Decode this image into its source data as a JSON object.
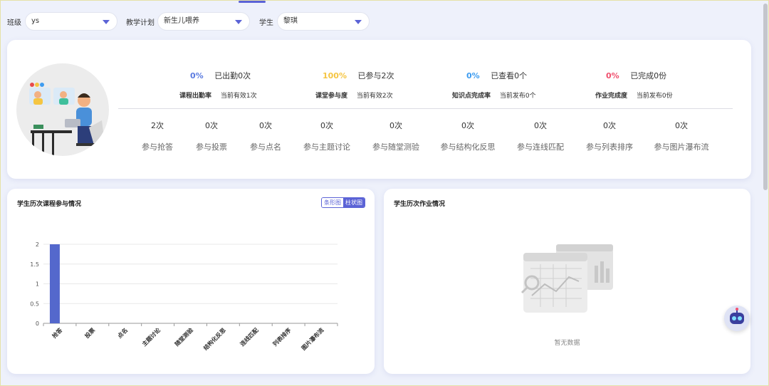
{
  "filters": [
    {
      "label": "班级",
      "value": "ys"
    },
    {
      "label": "教学计划",
      "value": "新生儿喂养"
    },
    {
      "label": "学生",
      "value": "黎琪"
    }
  ],
  "metrics": [
    {
      "pct": "0%",
      "pct_color": "#5b7be0",
      "count": "已出勤0次",
      "label": "课程出勤率",
      "sub": "当前有效1次"
    },
    {
      "pct": "100%",
      "pct_color": "#f5c542",
      "count": "已参与2次",
      "label": "课堂参与度",
      "sub": "当前有效2次"
    },
    {
      "pct": "0%",
      "pct_color": "#3d9cf0",
      "count": "已查看0个",
      "label": "知识点完成率",
      "sub": "当前发布0个"
    },
    {
      "pct": "0%",
      "pct_color": "#f0506e",
      "count": "已完成0份",
      "label": "作业完成度",
      "sub": "当前发布0份"
    }
  ],
  "activities": [
    {
      "value": "2次",
      "label": "参与抢答"
    },
    {
      "value": "0次",
      "label": "参与投票"
    },
    {
      "value": "0次",
      "label": "参与点名"
    },
    {
      "value": "0次",
      "label": "参与主题讨论"
    },
    {
      "value": "0次",
      "label": "参与随堂测验"
    },
    {
      "value": "0次",
      "label": "参与结构化反思"
    },
    {
      "value": "0次",
      "label": "参与连线匹配"
    },
    {
      "value": "0次",
      "label": "参与列表排序"
    },
    {
      "value": "0次",
      "label": "参与图片瀑布流"
    }
  ],
  "course_panel": {
    "title": "学生历次课程参与情况",
    "toggle": [
      "条形图",
      "柱状图"
    ],
    "active_toggle": "柱状图"
  },
  "homework_panel": {
    "title": "学生历次作业情况",
    "empty_text": "暂无数据"
  },
  "chart_data": {
    "type": "bar",
    "categories": [
      "抢答",
      "投票",
      "点名",
      "主题讨论",
      "随堂测验",
      "结构化反思",
      "连线匹配",
      "列表排序",
      "图片瀑布流"
    ],
    "values": [
      2,
      0,
      0,
      0,
      0,
      0,
      0,
      0,
      0
    ],
    "title": "",
    "xlabel": "",
    "ylabel": "",
    "ylim": [
      0,
      2
    ],
    "yticks": [
      "0",
      "0.5",
      "1",
      "1.5",
      "2"
    ],
    "grid": true,
    "bar_color": "#5468cc"
  }
}
